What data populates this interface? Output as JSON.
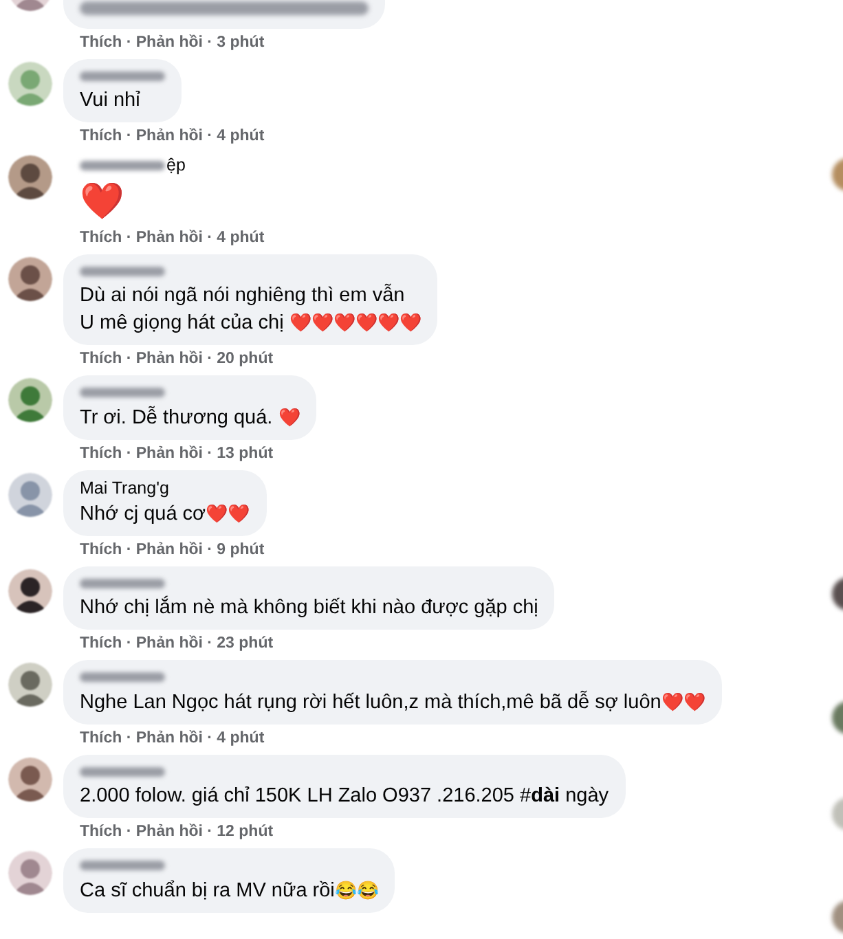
{
  "comments": [
    {
      "kind": "bubble",
      "meta": "Thích · Phản hồi · 3 phút"
    },
    {
      "kind": "bubble",
      "lines": [
        "Vui nhỉ"
      ],
      "meta": "Thích · Phản hồi · 4 phút"
    },
    {
      "kind": "sticker",
      "name": "ệp",
      "lines": [
        "❤️"
      ],
      "meta": "Thích · Phản hồi · 4 phút"
    },
    {
      "kind": "bubble",
      "lines": [
        "Dù ai nói ngã nói nghiêng thì em vẫn",
        "U mê giọng hát của chị ❤️❤️❤️❤️❤️❤️"
      ],
      "meta": "Thích · Phản hồi · 20 phút"
    },
    {
      "kind": "bubble",
      "lines": [
        "Tr ơi. Dễ thương quá. ❤️"
      ],
      "meta": "Thích · Phản hồi · 13 phút"
    },
    {
      "kind": "bubble",
      "name": "Mai Trang'g",
      "lines": [
        "Nhớ cj quá cơ❤️❤️"
      ],
      "meta": "Thích · Phản hồi · 9 phút"
    },
    {
      "kind": "bubble",
      "lines": [
        "Nhớ chị lắm nè mà không biết khi nào được gặp chị"
      ],
      "meta": "Thích · Phản hồi · 23 phút"
    },
    {
      "kind": "bubble",
      "lines": [
        "Nghe Lan Ngọc hát rụng rời hết luôn,z mà thích,mê bã dễ sợ luôn❤️❤️"
      ],
      "meta": "Thích · Phản hồi · 4 phút"
    },
    {
      "kind": "bubble",
      "lines": [
        "2.000 folow. giá chỉ 150K LH Zalo O937 .216.205 #**dài** ngày"
      ],
      "meta": "Thích · Phản hồi · 12 phút"
    },
    {
      "kind": "bubble",
      "lines": [
        "Ca sĩ chuẩn bị ra MV nữa rồi😂😂"
      ]
    }
  ]
}
